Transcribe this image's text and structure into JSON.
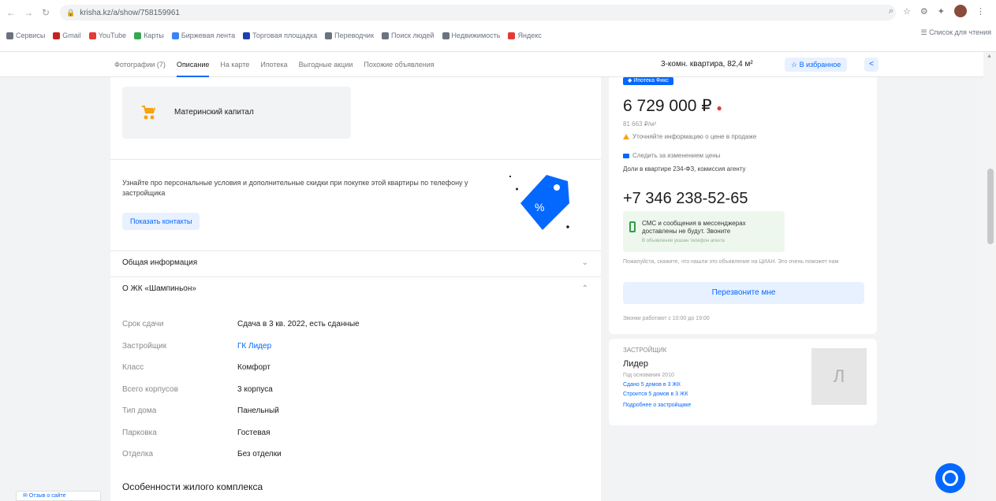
{
  "browser": {
    "url": "krisha.kz/a/show/758159961",
    "bookmarks": [
      {
        "label": "Сервисы",
        "color": "#6b7280"
      },
      {
        "label": "Gmail",
        "color": "#c5221f"
      },
      {
        "label": "YouTube",
        "color": "#e53935"
      },
      {
        "label": "Карты",
        "color": "#34a853"
      },
      {
        "label": "Биржевая лента",
        "color": "#3b82f6"
      },
      {
        "label": "Торговая площадка",
        "color": "#1e40af"
      },
      {
        "label": "Переводчик",
        "color": "#6b7280"
      },
      {
        "label": "Поиск людей",
        "color": "#6b7280"
      },
      {
        "label": "Недвижимость",
        "color": "#6b7280"
      },
      {
        "label": "Яндекс",
        "color": "#e53935"
      }
    ],
    "reading_list": "Список для чтения"
  },
  "nav": {
    "tabs": [
      "Фотографии (7)",
      "Описание",
      "На карте",
      "Ипотека",
      "Выгодные акции",
      "Похожие объявления"
    ],
    "active_tab": 1,
    "summary": "3-комн. квартира, 82,4 м²",
    "favorite": "☆ В избранное",
    "share": "<"
  },
  "capital": {
    "label": "Материнский капитал"
  },
  "promo": {
    "text": "Узнайте про персональные условия и дополнительные скидки при покупке этой квартиры по телефону у застройщика",
    "button": "Показать контакты"
  },
  "sections": {
    "general": "Общая информация",
    "complex": "О ЖК «Шампиньон»"
  },
  "specs": [
    {
      "k": "Срок сдачи",
      "v": "Сдача в 3 кв. 2022, есть сданные",
      "link": false
    },
    {
      "k": "Застройщик",
      "v": "ГК Лидер",
      "link": true
    },
    {
      "k": "Класс",
      "v": "Комфорт",
      "link": false
    },
    {
      "k": "Всего корпусов",
      "v": "3 корпуса",
      "link": false
    },
    {
      "k": "Тип дома",
      "v": "Панельный",
      "link": false
    },
    {
      "k": "Парковка",
      "v": "Гостевая",
      "link": false
    },
    {
      "k": "Отделка",
      "v": "Без отделки",
      "link": false
    }
  ],
  "features_title": "Особенности жилого комплекса",
  "offer": {
    "badge": "◆ Ипотека Фикс",
    "price": "6 729 000 ₽",
    "price_marker": "●",
    "per_m2": "81 663 ₽/м²",
    "info1": "Уточняйте информацию о цене в продаже",
    "info2": "Следить за изменением цены",
    "details": "Доли в квартире 234-ФЗ, комиссия агенту",
    "phone": "+7 346 238-52-65",
    "sms_text": "СМС и сообщения в мессенджерах доставлены не будут. Звоните",
    "sms_sub": "В объявлении указан телефон агента",
    "warning": "Пожалуйста, скажите, что нашли это объявление на ЦИАН. Это очень поможет нам",
    "callback": "Перезвоните мне",
    "hours": "Звонки работают с 10:00 до 19:00"
  },
  "developer": {
    "title": "ЗАСТРОЙЩИК",
    "name": "Лидер",
    "founded": "Год основания 2010",
    "stat1": "Сдано 5 домов в 3 ЖК",
    "stat2": "Строится 5 домов в 3 ЖК",
    "more": "Подробнее о застройщике",
    "logo": "Л"
  },
  "feedback": "✉ Отзыв о сайте"
}
